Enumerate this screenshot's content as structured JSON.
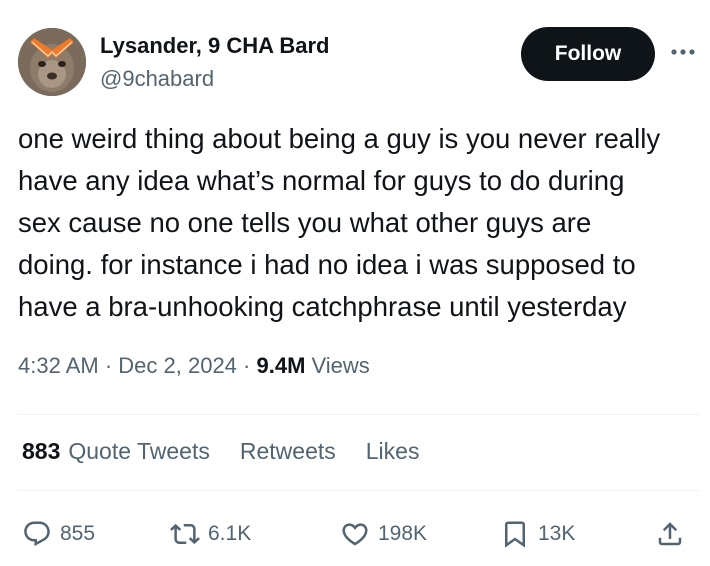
{
  "author": {
    "name": "Lysander, 9 CHA Bard",
    "handle": "@9chabard"
  },
  "header": {
    "follow_label": "Follow",
    "more_icon": "more-horizontal-icon"
  },
  "tweet": {
    "lines": [
      "one weird thing about being a guy is you never really",
      "have any idea what’s normal for guys to do during",
      "sex cause no one tells you what other guys are",
      "doing. for instance i had no idea i was supposed to",
      "have a bra-unhooking catchphrase until yesterday"
    ]
  },
  "meta": {
    "time": "4:32 AM",
    "sep1": " · ",
    "date": "Dec 2, 2024",
    "sep2": " · ",
    "views_count": "9.4M",
    "views_label": " Views"
  },
  "stats": {
    "quote_count": "883",
    "quote_label": "Quote Tweets",
    "retweets_label": "Retweets",
    "likes_label": "Likes"
  },
  "actions": {
    "reply_count": "855",
    "retweet_count": "6.1K",
    "like_count": "198K",
    "bookmark_count": "13K"
  },
  "colors": {
    "text_primary": "#0f1419",
    "text_secondary": "#536471",
    "follow_bg": "#0f1419",
    "divider": "#eff3f4"
  }
}
